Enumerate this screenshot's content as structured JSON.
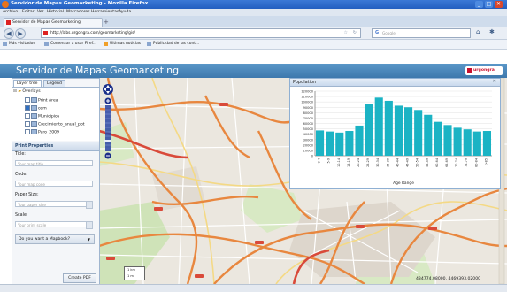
{
  "window": {
    "title": "Servidor de Mapas Geomarketing - Mozilla Firefox",
    "minimize": "_",
    "maximize": "□",
    "close": "✕"
  },
  "menu": [
    "Archivo",
    "Editar",
    "Ver",
    "Historial",
    "Marcadores",
    "Herramientas",
    "Ayuda"
  ],
  "tab": {
    "label": "Servidor de Mapas Geomarketing",
    "add": "+"
  },
  "nav": {
    "back": "◀",
    "forward": "▶",
    "url": "http://labs.urgongra.com/geomarketing/gis/",
    "search_placeholder": "Google"
  },
  "bookmarks": [
    "Más visitados",
    "Comenzar a usar Firef...",
    "Últimas noticias",
    "Publicidad de las cont..."
  ],
  "app": {
    "title": "Servidor de Mapas Geomarketing",
    "logo_text": "urgongra"
  },
  "left_panel": {
    "tabs": [
      "Layer tree",
      "Legend"
    ],
    "tree": [
      {
        "label": "Overlays",
        "level": 0
      },
      {
        "label": "Print Area",
        "level": 1
      },
      {
        "label": "osm",
        "level": 1
      },
      {
        "label": "Municipios",
        "level": 1
      },
      {
        "label": "Crecimiento_anual_pot",
        "level": 1
      },
      {
        "label": "Paro_2009",
        "level": 1
      }
    ],
    "print_properties": {
      "header": "Print Properties",
      "title_label": "Title:",
      "title_placeholder": "Your map title",
      "code_label": "Code:",
      "code_placeholder": "Your map code",
      "paper_label": "Paper Size:",
      "paper_placeholder": "Your paper size",
      "scale_label": "Scale:",
      "scale_placeholder": "Your print scale",
      "mapbook_label": "Do you want a Mapbook?",
      "create_pdf": "Create PDF"
    }
  },
  "chart_window": {
    "title": "Population",
    "controls": "- ✕"
  },
  "chart_data": {
    "type": "bar",
    "title": "",
    "xlabel": "Age Range",
    "ylabel": "",
    "categories": [
      "0-4",
      "5-9",
      "10-14",
      "15-19",
      "20-24",
      "25-29",
      "30-34",
      "35-39",
      "40-44",
      "45-49",
      "50-54",
      "55-59",
      "60-64",
      "65-69",
      "70-74",
      "75-79",
      "80-84",
      ">85"
    ],
    "values": [
      47000,
      45000,
      43000,
      46000,
      56000,
      96000,
      108000,
      102000,
      93000,
      90000,
      85000,
      76000,
      63000,
      57000,
      52000,
      49000,
      45000,
      46000
    ],
    "ylim": [
      0,
      120000
    ],
    "yticks": [
      0,
      5000,
      10000,
      15000,
      20000,
      25000,
      30000,
      35000,
      40000,
      45000,
      50000,
      55000,
      60000,
      65000,
      70000,
      75000,
      80000,
      85000,
      90000,
      95000,
      100000,
      105000,
      110000,
      115000,
      120000
    ],
    "ytick_labels": [
      "0",
      "5000",
      "10000",
      "15000",
      "20000",
      "25000",
      "30000",
      "35000",
      "40000",
      "45000",
      "50000",
      "55000",
      "60000",
      "65000",
      "70000",
      "75000",
      "80000",
      "85000",
      "90000",
      "95000",
      "100000",
      "105000",
      "110000",
      "115000",
      "120000"
    ],
    "grid": true,
    "bar_color": "#1bb3c4"
  },
  "map": {
    "coordinates": "434774.08000, 4469393.02000",
    "scale_label_top": "1 km",
    "scale_label_bottom": "1 mi"
  },
  "colors": {
    "header": "#4a86bb",
    "accent": "#c8102e",
    "road": "#e8873f"
  }
}
